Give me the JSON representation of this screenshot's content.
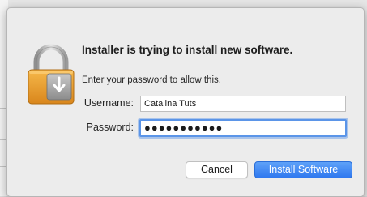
{
  "dialog": {
    "title": "Installer is trying to install new software.",
    "message": "Enter your password to allow this.",
    "username_label": "Username:",
    "username_value": "Catalina Tuts",
    "password_label": "Password:",
    "password_value": "●●●●●●●●●●●",
    "cancel_label": "Cancel",
    "install_label": "Install Software",
    "icon": "lock-icon"
  },
  "colors": {
    "accent": "#3a83f3",
    "focus_ring": "#5b95e8",
    "lock_body": "#e69a2e",
    "dialog_bg": "#ececec"
  }
}
